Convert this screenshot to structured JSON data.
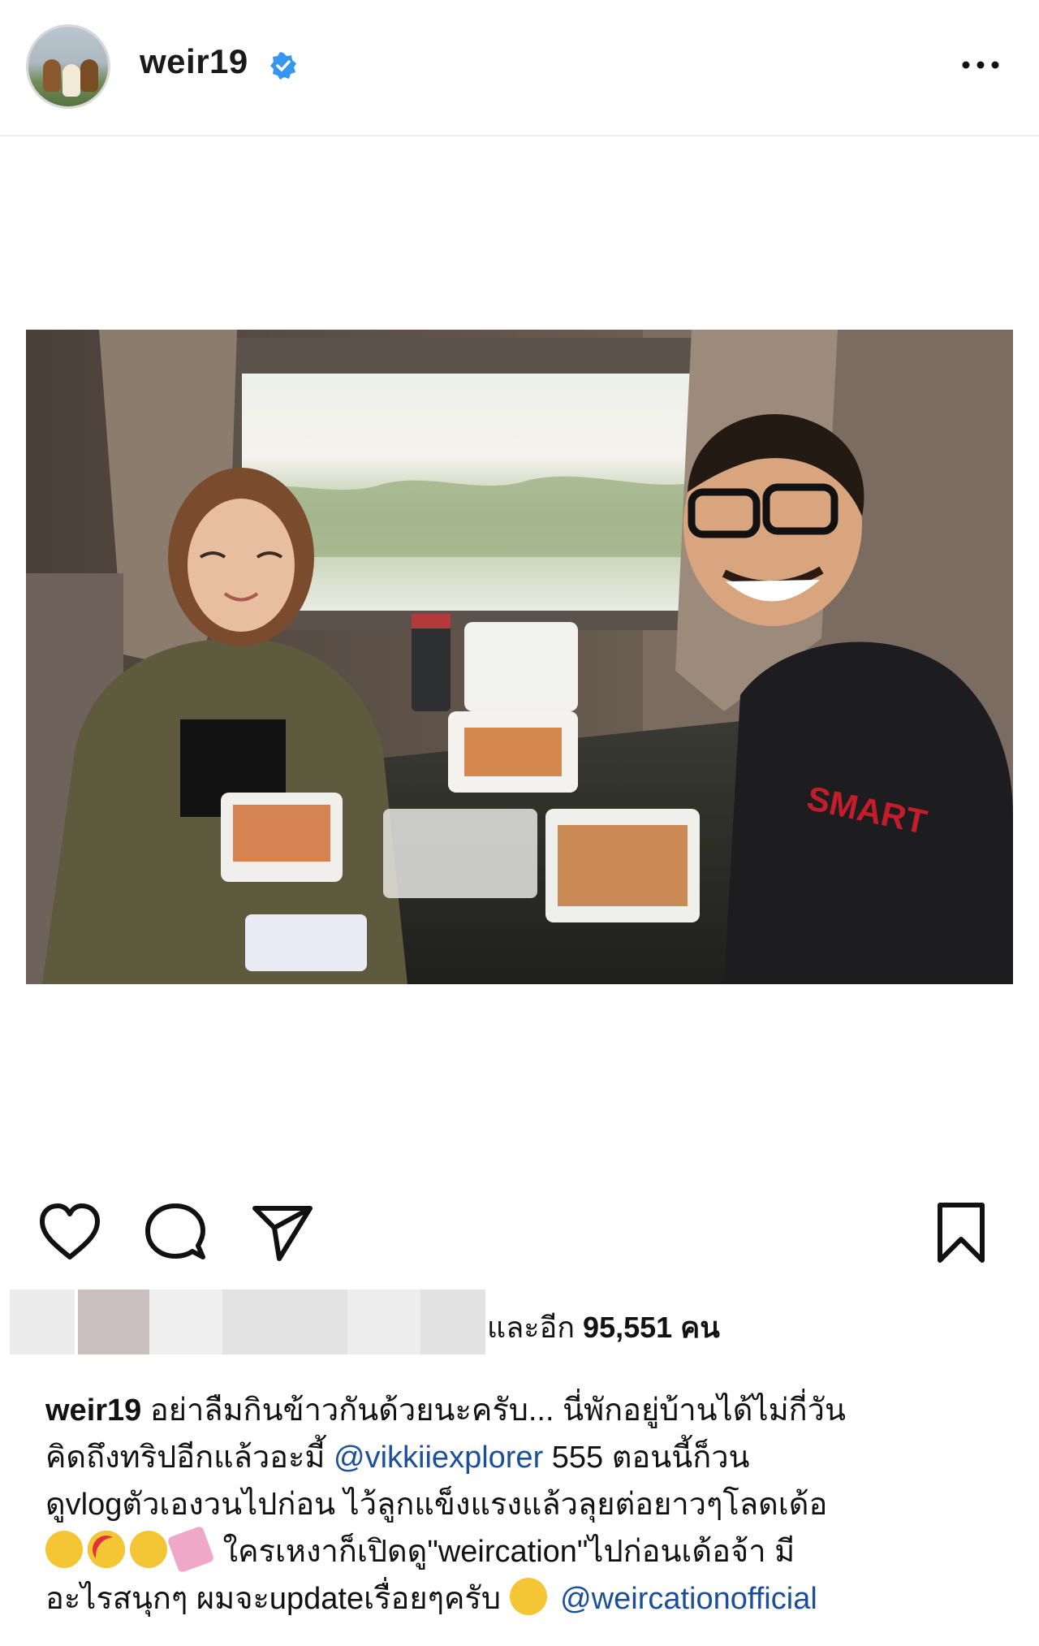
{
  "header": {
    "username": "weir19",
    "verified": true,
    "accent_color": "#3797f0"
  },
  "post": {
    "image_alt": "Selfie of two people eating takeaway food by a window",
    "actions": {
      "like_icon": "heart-icon",
      "comment_icon": "comment-icon",
      "share_icon": "send-icon",
      "save_icon": "bookmark-icon"
    },
    "likes": {
      "prefix": "และอีก",
      "count": "95,551",
      "suffix": "คน"
    },
    "caption": {
      "username": "weir19",
      "line1": "อย่าลืมกินข้าวกันด้วยนะครับ... นี่พักอยู่บ้านได้ไม่กี่วัน",
      "line2_before": "คิดถึงทริปอีกแล้วอะมี้ ",
      "mention1": "@vikkiiexplorer",
      "line2_after": " 555 ตอนนี้ก็วน",
      "line3": "ดูvlogตัวเองวนไปก่อน ไว้ลูกแข็งแรงแล้วลุยต่อยาวๆโลดเด้อ",
      "line4": " ใครเหงาก็เปิดดู\"weircation\"ไปก่อนเด้อจ้า มี",
      "line5": "อะไรสนุกๆ ผมจะupdateเรื่อยๆครับ",
      "mention2": "@weircationofficial"
    },
    "mention_color": "#1b4f9b"
  }
}
